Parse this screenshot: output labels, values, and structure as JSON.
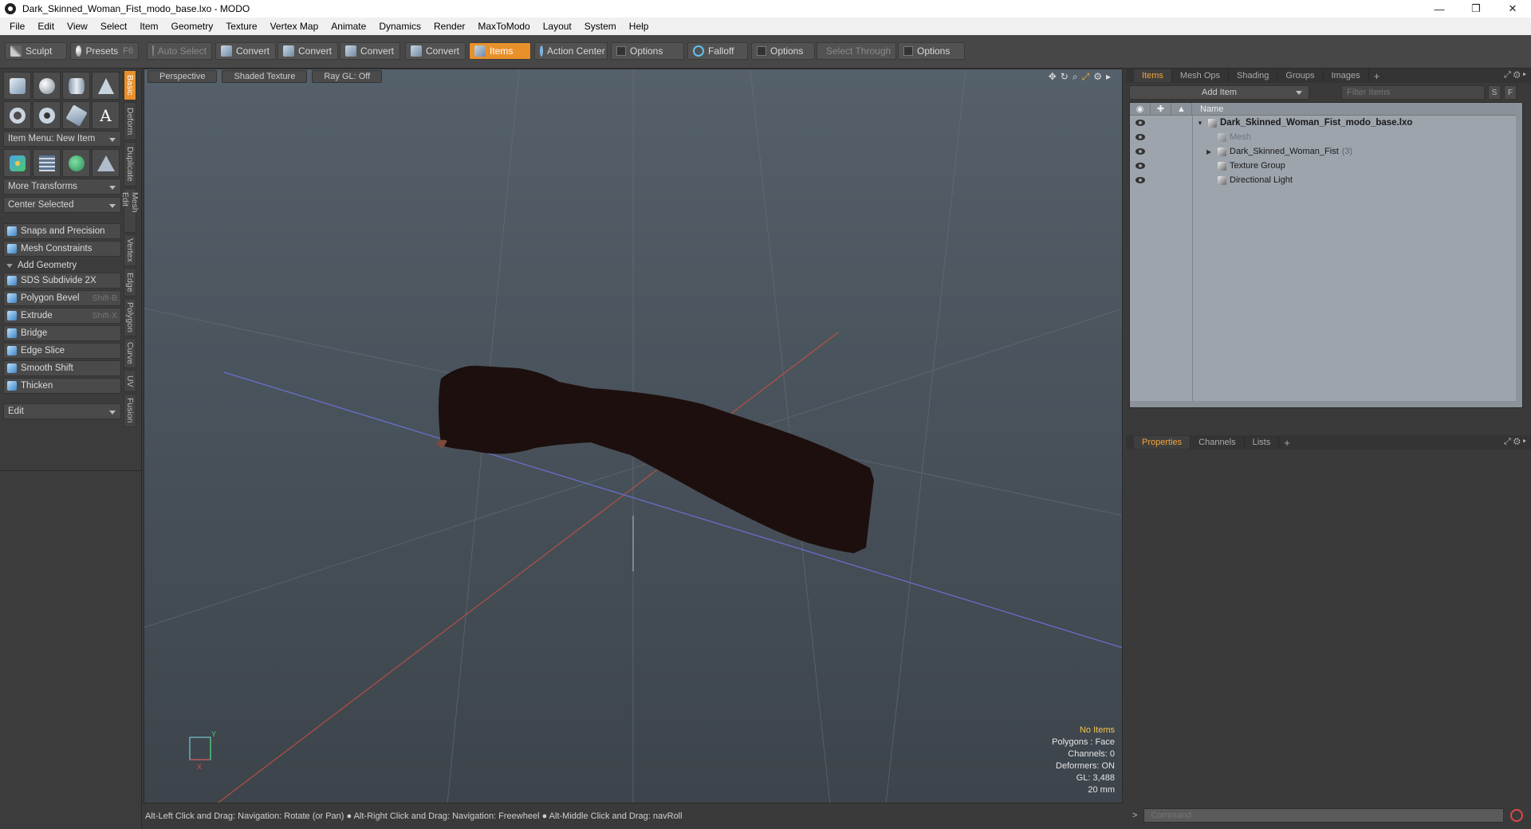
{
  "window": {
    "title": "Dark_Skinned_Woman_Fist_modo_base.lxo - MODO",
    "minimize": "—",
    "restore": "❐",
    "close": "✕"
  },
  "menu": [
    "File",
    "Edit",
    "View",
    "Select",
    "Item",
    "Geometry",
    "Texture",
    "Vertex Map",
    "Animate",
    "Dynamics",
    "Render",
    "MaxToModo",
    "Layout",
    "System",
    "Help"
  ],
  "toolbar": {
    "sculpt": "Sculpt",
    "presets": "Presets",
    "presets_key": "F6",
    "auto_select": "Auto Select",
    "convert_1": "Convert",
    "convert_2": "Convert",
    "convert_3": "Convert",
    "convert_4": "Convert",
    "items": "Items",
    "action_center": "Action Center",
    "options_1": "Options",
    "falloff": "Falloff",
    "options_2": "Options",
    "select_through": "Select Through",
    "options_3": "Options"
  },
  "left": {
    "item_menu": "Item Menu: New Item",
    "more_transforms": "More Transforms",
    "center_selected": "Center Selected",
    "snaps": "Snaps and Precision",
    "mesh_constraints": "Mesh Constraints",
    "add_geometry": "Add Geometry",
    "tools": [
      {
        "label": "SDS Subdivide 2X",
        "key": ""
      },
      {
        "label": "Polygon Bevel",
        "key": "Shift-B"
      },
      {
        "label": "Extrude",
        "key": "Shift-X"
      },
      {
        "label": "Bridge",
        "key": ""
      },
      {
        "label": "Edge Slice",
        "key": ""
      },
      {
        "label": "Smooth Shift",
        "key": ""
      },
      {
        "label": "Thicken",
        "key": ""
      }
    ],
    "edit": "Edit",
    "vtabs": [
      "Basic",
      "Deform",
      "Duplicate",
      "Mesh Edit",
      "Vertex",
      "Edge",
      "Polygon",
      "Curve",
      "UV",
      "Fusion"
    ]
  },
  "viewport": {
    "perspective": "Perspective",
    "shading": "Shaded Texture",
    "raygl": "Ray GL: Off",
    "stats": {
      "no_items": "No Items",
      "polygons": "Polygons : Face",
      "channels": "Channels: 0",
      "deformers": "Deformers: ON",
      "gl": "GL: 3,488",
      "scale": "20 mm"
    }
  },
  "status": "Alt-Left Click and Drag: Navigation: Rotate (or Pan) ● Alt-Right Click and Drag: Navigation: Freewheel ● Alt-Middle Click and Drag: navRoll",
  "items_panel": {
    "tabs": [
      "Items",
      "Mesh Ops",
      "Shading",
      "Groups",
      "Images"
    ],
    "add_item": "Add Item",
    "filter_placeholder": "Filter Items",
    "s_btn": "S",
    "f_btn": "F",
    "name_col": "Name",
    "tree": [
      {
        "label": "Dark_Skinned_Woman_Fist_modo_base.lxo",
        "count": ""
      },
      {
        "label": "Mesh",
        "count": ""
      },
      {
        "label": "Dark_Skinned_Woman_Fist",
        "count": "(3)"
      },
      {
        "label": "Texture Group",
        "count": ""
      },
      {
        "label": "Directional Light",
        "count": ""
      }
    ]
  },
  "props_panel": {
    "tabs": [
      "Properties",
      "Channels",
      "Lists"
    ]
  },
  "command": {
    "prompt": ">",
    "placeholder": "Command"
  }
}
